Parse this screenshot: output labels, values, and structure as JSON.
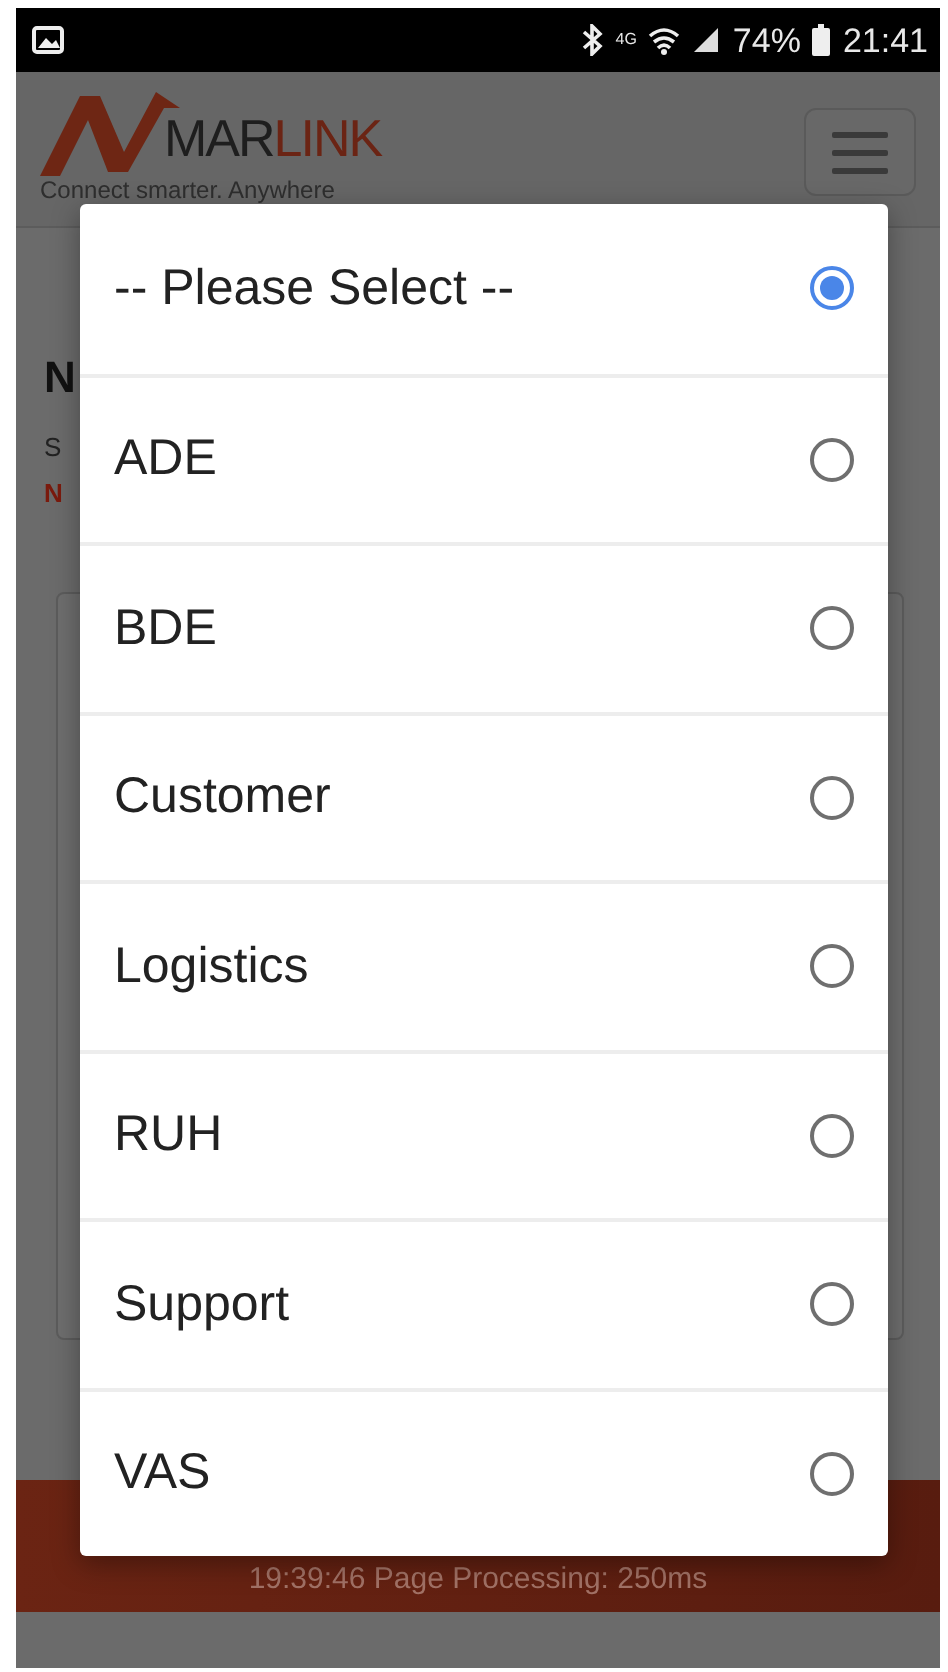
{
  "status_bar": {
    "network": "4G",
    "battery": "74%",
    "time": "21:41"
  },
  "header": {
    "logo": {
      "part_1": "MAR",
      "part_2": "LINK"
    },
    "tagline": "Connect smarter. Anywhere"
  },
  "page_fragments": {
    "heading": "N",
    "subtitle": "S",
    "notice": "N"
  },
  "footer": {
    "text": "19:39:46 Page Processing: 250ms"
  },
  "select_dialog": {
    "options": [
      {
        "label": "-- Please Select --",
        "selected": true
      },
      {
        "label": "ADE",
        "selected": false
      },
      {
        "label": "BDE",
        "selected": false
      },
      {
        "label": "Customer",
        "selected": false
      },
      {
        "label": "Logistics",
        "selected": false
      },
      {
        "label": "RUH",
        "selected": false
      },
      {
        "label": "Support",
        "selected": false
      },
      {
        "label": "VAS",
        "selected": false
      }
    ]
  }
}
